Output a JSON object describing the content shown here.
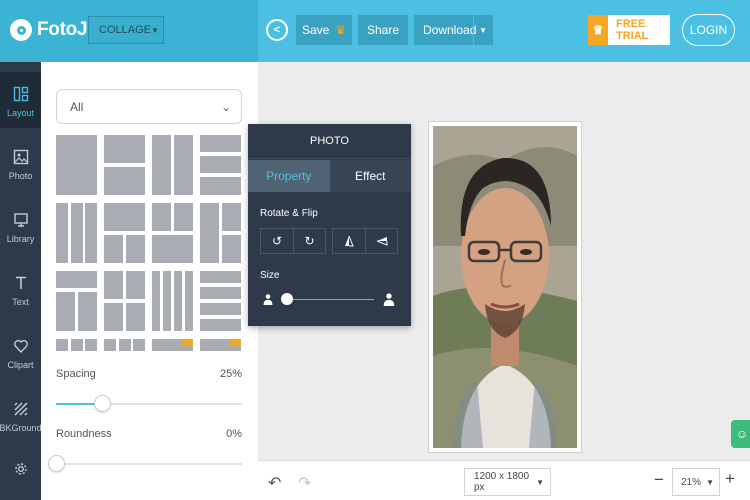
{
  "app": {
    "logo_text": "FotoJet"
  },
  "header": {
    "mode_select": "COLLAGE",
    "save_label": "Save",
    "share_label": "Share",
    "download_label": "Download",
    "trial_label": "FREE TRIAL",
    "login_label": "LOGIN"
  },
  "nav": {
    "items": [
      {
        "label": "Layout",
        "icon": "layout-icon",
        "active": true
      },
      {
        "label": "Photo",
        "icon": "image-icon",
        "active": false
      },
      {
        "label": "Library",
        "icon": "monitor-icon",
        "active": false
      },
      {
        "label": "Text",
        "icon": "text-icon",
        "active": false
      },
      {
        "label": "Clipart",
        "icon": "heart-icon",
        "active": false
      },
      {
        "label": "BKGround",
        "icon": "stripes-icon",
        "active": false
      },
      {
        "label": "",
        "icon": "gear-icon",
        "active": false
      }
    ]
  },
  "layout_panel": {
    "filter_value": "All",
    "spacing_label": "Spacing",
    "spacing_value": "25%",
    "spacing_fraction": 0.25,
    "roundness_label": "Roundness",
    "roundness_value": "0%",
    "roundness_fraction": 0
  },
  "photo_popup": {
    "title": "PHOTO",
    "tabs": [
      "Property",
      "Effect"
    ],
    "active_tab": "Property",
    "rotate_flip_label": "Rotate & Flip",
    "size_label": "Size",
    "size_fraction": 0.05
  },
  "bottom_bar": {
    "canvas_size": "1200 x 1800 px",
    "zoom_value": "21%"
  },
  "colors": {
    "header_blue": "#4cc0e2",
    "nav_dark": "#2c3a4a",
    "accent": "#4cc0e2",
    "trial_orange": "#f5a623"
  }
}
